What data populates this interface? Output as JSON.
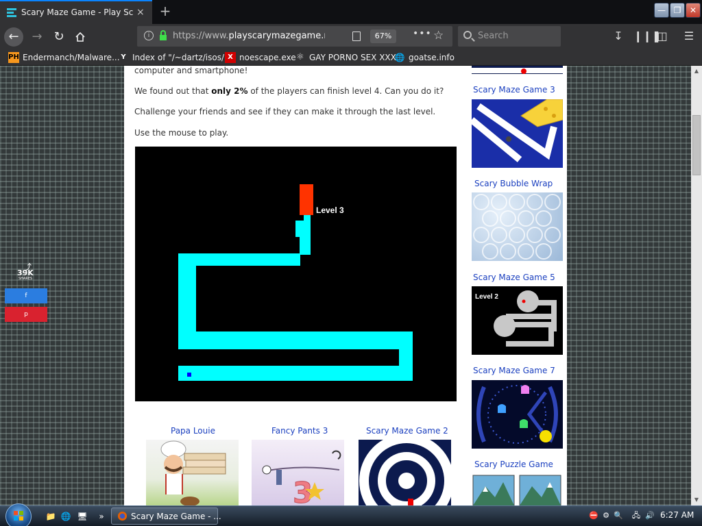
{
  "browser": {
    "tab_title": "Scary Maze Game - Play Scary Maz",
    "tab_close": "×",
    "new_tab": "+",
    "url_host": "https://www.",
    "url_domain": "playscarymazegame.net",
    "zoom": "67%",
    "search_placeholder": "Search",
    "window_controls": {
      "minimize": "—",
      "maximize": "❐",
      "close": "✕"
    }
  },
  "bookmarks": [
    {
      "icon": "PH",
      "label": "Endermanch/Malware..."
    },
    {
      "icon": "Y",
      "label": "Index of \"/~dartz/isos/\""
    },
    {
      "icon": "X",
      "label": "noescape.exe"
    },
    {
      "icon": "⚛",
      "label": "GAY PORNO SEX XXX"
    },
    {
      "icon": "🌐",
      "label": "goatse.info"
    }
  ],
  "page": {
    "intro_tail": "computer and smartphone!",
    "finish_pre": "We found out that ",
    "finish_bold": "only 2%",
    "finish_post": " of the players can finish level 4. Can you do it?",
    "challenge": "Challenge your friends and see if they can make it through the last level.",
    "instructions": "Use the mouse to play.",
    "game": {
      "level_label": "Level 3",
      "path_color": "#00ffff",
      "goal_color": "#ff3300",
      "player_color": "#0000ff"
    },
    "bottom_games": [
      "Papa Louie",
      "Fancy Pants 3",
      "Scary Maze Game 2"
    ],
    "side_games": [
      "Scary Maze Game 3",
      "Scary Bubble Wrap",
      "Scary Maze Game 5",
      "Scary Maze Game 7",
      "Scary Puzzle Game"
    ],
    "side_thumb_level": "Level 2",
    "fancy_pants_number": "3"
  },
  "share": {
    "count": "39K",
    "label": "SHARES",
    "facebook": "f",
    "pinterest": "p"
  },
  "taskbar": {
    "task_label": "Scary Maze Game - ...",
    "clock": "6:27 AM",
    "expand": "»"
  }
}
